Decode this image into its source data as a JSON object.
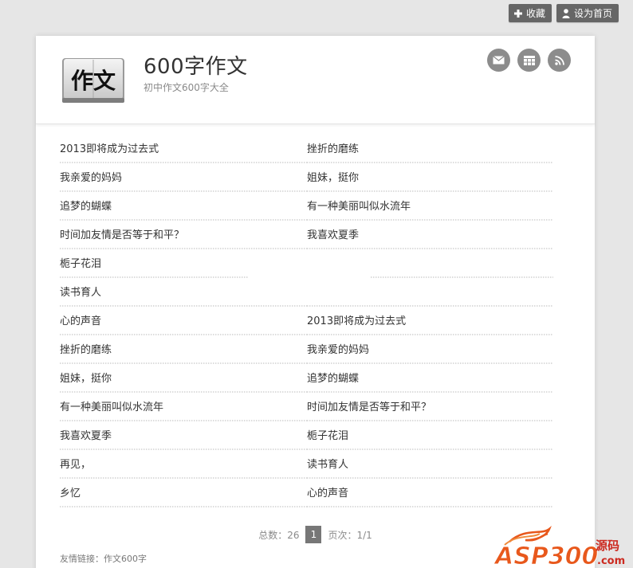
{
  "topbar": {
    "favorite_label": "收藏",
    "homepage_label": "设为首页"
  },
  "header": {
    "logo_text": "作文",
    "title": "600字作文",
    "subtitle": "初中作文600字大全"
  },
  "articles": {
    "rows": [
      {
        "left": "2013即将成为过去式",
        "right": "挫折的磨练"
      },
      {
        "left": "我亲爱的妈妈",
        "right": "姐妹，挺你"
      },
      {
        "left": "追梦的蝴蝶",
        "right": "有一种美丽叫似水流年"
      },
      {
        "left": "时间加友情是否等于和平？",
        "right": "我喜欢夏季"
      },
      {
        "left": "栀子花泪",
        "right": ""
      },
      {
        "left": "读书育人",
        "right": ""
      },
      {
        "left": "心的声音",
        "right": "2013即将成为过去式"
      },
      {
        "left": "挫折的磨练",
        "right": "我亲爱的妈妈"
      },
      {
        "left": "姐妹，挺你",
        "right": "追梦的蝴蝶"
      },
      {
        "left": "有一种美丽叫似水流年",
        "right": "时间加友情是否等于和平？"
      },
      {
        "left": "我喜欢夏季",
        "right": "栀子花泪"
      },
      {
        "left": "再见，",
        "right": "读书育人"
      },
      {
        "left": "乡忆",
        "right": "心的声音"
      }
    ]
  },
  "pager": {
    "total_label": "总数：26",
    "current_page": "1",
    "pages_label": "页次：1/1"
  },
  "footer": {
    "friends_label": "友情链接：",
    "friend_link": "作文600字"
  },
  "watermark": {
    "brand": "ASP300",
    "brand_cn": "源码",
    "domain": ".com"
  },
  "colors": {
    "button_bg": "#666666",
    "social_bg": "#8c8c8c",
    "page_current_bg": "#777777",
    "watermark_orange": "#e8581c",
    "watermark_red": "#cc2a20"
  }
}
